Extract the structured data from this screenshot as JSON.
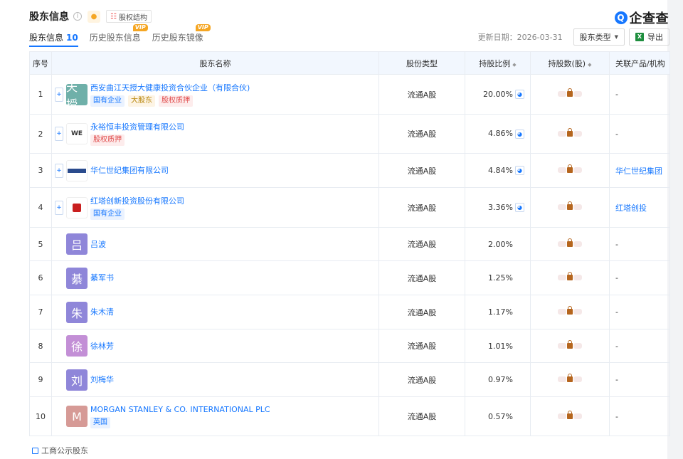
{
  "header": {
    "title": "股东信息",
    "structure_btn": "股权结构"
  },
  "logo": {
    "text": "企查查"
  },
  "tabs": [
    {
      "label": "股东信息",
      "count": "10",
      "active": true
    },
    {
      "label": "历史股东信息",
      "badge": "VIP"
    },
    {
      "label": "历史股东镜像",
      "badge": "VIP"
    }
  ],
  "toolbar": {
    "update_date": "更新日期：2026-03-31",
    "type_select": "股东类型",
    "export": "导出"
  },
  "table": {
    "headers": [
      "序号",
      "股东名称",
      "股份类型",
      "持股比例",
      "持股数(股)",
      "关联产品/机构"
    ],
    "rows": [
      {
        "no": "1",
        "avatar": "天授",
        "avatar_color": "#6fb0a9",
        "name": "西安曲江天授大健康投资合伙企业（有限合伙)",
        "tags": [
          {
            "t": "国有企业",
            "c": "blue"
          },
          {
            "t": "大股东",
            "c": "gold"
          },
          {
            "t": "股权质押",
            "c": "red"
          }
        ],
        "type": "流通A股",
        "ratio": "20.00%",
        "product": "-",
        "expand": true,
        "pie": true
      },
      {
        "no": "2",
        "avatar": "WE",
        "avatar_color": "#ffffff",
        "name": "永裕恒丰投资管理有限公司",
        "tags": [
          {
            "t": "股权质押",
            "c": "red"
          }
        ],
        "type": "流通A股",
        "ratio": "4.86%",
        "product": "-",
        "expand": true,
        "pie": true
      },
      {
        "no": "3",
        "avatar": "",
        "avatar_color": "#ffffff",
        "name": "华仁世纪集团有限公司",
        "tags": [],
        "type": "流通A股",
        "ratio": "4.84%",
        "product": "华仁世纪集团",
        "expand": true,
        "pie": true
      },
      {
        "no": "4",
        "avatar": "",
        "avatar_color": "#ffffff",
        "name": "红塔创新投资股份有限公司",
        "tags": [
          {
            "t": "国有企业",
            "c": "blue"
          }
        ],
        "type": "流通A股",
        "ratio": "3.36%",
        "product": "红塔创投",
        "expand": true,
        "pie": true
      },
      {
        "no": "5",
        "avatar": "吕",
        "avatar_color": "#8f86d9",
        "name": "吕波",
        "tags": [],
        "type": "流通A股",
        "ratio": "2.00%",
        "product": "-",
        "expand": false,
        "pie": false
      },
      {
        "no": "6",
        "avatar": "綦",
        "avatar_color": "#8f86d9",
        "name": "綦军书",
        "tags": [],
        "type": "流通A股",
        "ratio": "1.25%",
        "product": "-",
        "expand": false,
        "pie": false
      },
      {
        "no": "7",
        "avatar": "朱",
        "avatar_color": "#8f86d9",
        "name": "朱木清",
        "tags": [],
        "type": "流通A股",
        "ratio": "1.17%",
        "product": "-",
        "expand": false,
        "pie": false
      },
      {
        "no": "8",
        "avatar": "徐",
        "avatar_color": "#c38fd6",
        "name": "徐林芳",
        "tags": [],
        "type": "流通A股",
        "ratio": "1.01%",
        "product": "-",
        "expand": false,
        "pie": false
      },
      {
        "no": "9",
        "avatar": "刘",
        "avatar_color": "#8f86d9",
        "name": "刘梅华",
        "tags": [],
        "type": "流通A股",
        "ratio": "0.97%",
        "product": "-",
        "expand": false,
        "pie": false
      },
      {
        "no": "10",
        "avatar": "M",
        "avatar_color": "#d69a96",
        "name": "MORGAN STANLEY & CO. INTERNATIONAL PLC",
        "tags": [
          {
            "t": "英国",
            "c": "blue"
          }
        ],
        "type": "流通A股",
        "ratio": "0.57%",
        "product": "-",
        "expand": false,
        "pie": false
      }
    ]
  },
  "footer": {
    "label": "工商公示股东"
  },
  "colors": {
    "accent": "#1677ff",
    "vip": "#f5a623",
    "header_bg": "#f2f7fe"
  }
}
